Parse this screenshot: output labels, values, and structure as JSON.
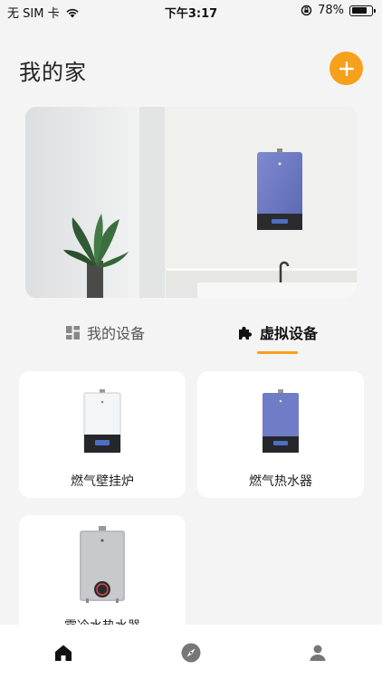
{
  "status_bar": {
    "carrier": "无 SIM 卡",
    "time": "下午3:17",
    "battery_percent": "78%",
    "battery_level": 0.78
  },
  "header": {
    "title": "我的家"
  },
  "tabs": [
    {
      "label": "我的设备",
      "active": false
    },
    {
      "label": "虚拟设备",
      "active": true
    }
  ],
  "devices": [
    {
      "name": "燃气壁挂炉"
    },
    {
      "name": "燃气热水器"
    },
    {
      "name": "零冷水热水器"
    }
  ],
  "colors": {
    "accent": "#f7a01b",
    "background": "#f4f4f4"
  },
  "bottom_nav": [
    {
      "icon": "home-icon",
      "active": true
    },
    {
      "icon": "compass-icon",
      "active": false
    },
    {
      "icon": "user-icon",
      "active": false
    }
  ]
}
